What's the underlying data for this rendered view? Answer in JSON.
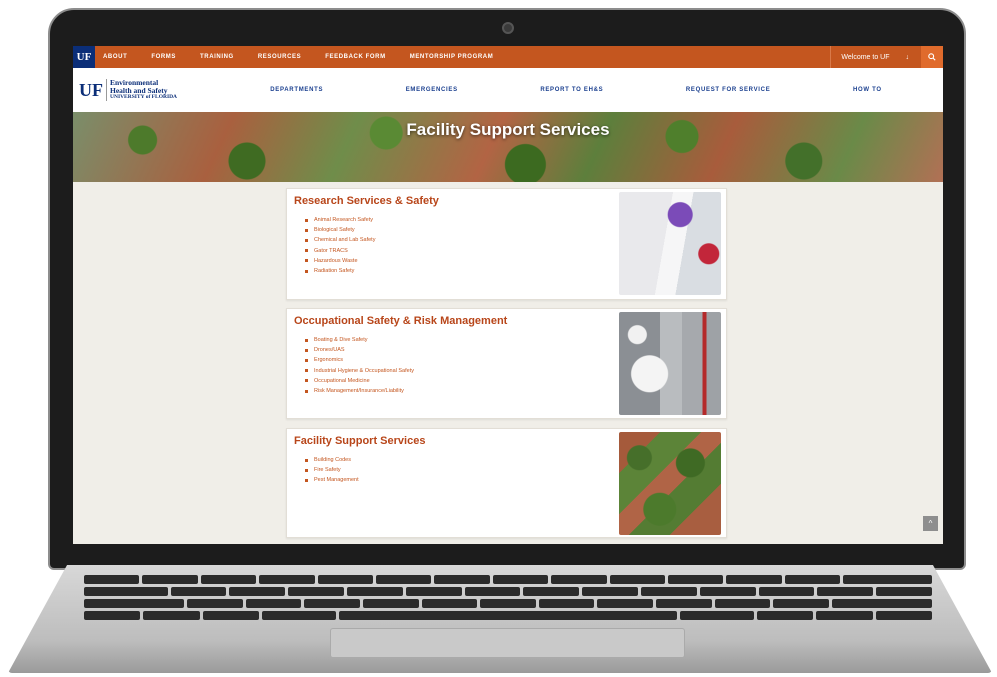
{
  "topbar": {
    "uf_badge": "UF",
    "items": [
      "ABOUT",
      "FORMS",
      "TRAINING",
      "RESOURCES",
      "FEEDBACK FORM",
      "MENTORSHIP PROGRAM"
    ],
    "welcome": "Welcome to UF",
    "welcome_icon": "arrow-down-icon",
    "search_icon": "search-icon"
  },
  "logo": {
    "uf": "UF",
    "line1a": "Environmental",
    "line1b": "Health and Safety",
    "line2": "UNIVERSITY of FLORIDA"
  },
  "mainnav": {
    "items": [
      "DEPARTMENTS",
      "EMERGENCIES",
      "REPORT TO EH&S",
      "REQUEST FOR SERVICE",
      "HOW TO"
    ]
  },
  "hero": {
    "title": "Facility Support Services"
  },
  "cards": [
    {
      "title": "Research Services & Safety",
      "items": [
        "Animal Research Safety",
        "Biological Safety",
        "Chemical and Lab Safety",
        "Gator TRACS",
        "Hazardous Waste",
        "Radiation Safety"
      ]
    },
    {
      "title": "Occupational Safety & Risk Management",
      "items": [
        "Boating & Dive Safety",
        "Drones/UAS",
        "Ergonomics",
        "Industrial Hygiene & Occupational Safety",
        "Occupational Medicine",
        "Risk Management/Insurance/Liability"
      ]
    },
    {
      "title": "Facility Support Services",
      "items": [
        "Building Codes",
        "Fire Safety",
        "Pest Management"
      ]
    }
  ],
  "colors": {
    "accent": "#c4561f",
    "brand_blue": "#0b2e78",
    "title_orange": "#b8461a"
  }
}
